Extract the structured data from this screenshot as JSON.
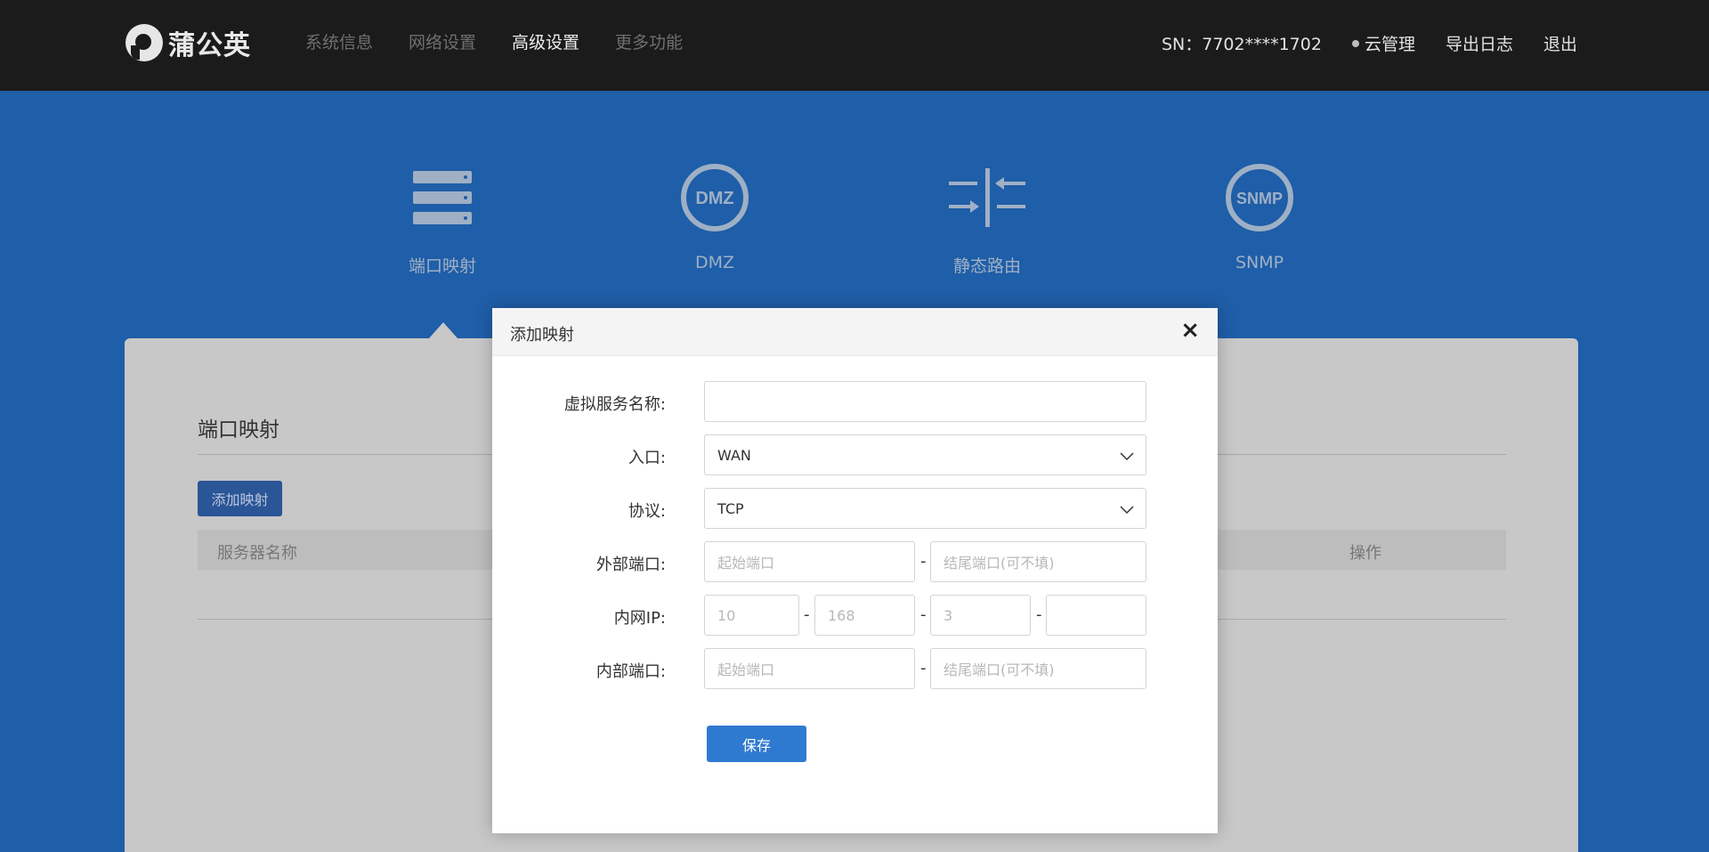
{
  "brand": {
    "name": "蒲公英"
  },
  "nav": {
    "items": [
      {
        "label": "系统信息",
        "active": false
      },
      {
        "label": "网络设置",
        "active": false
      },
      {
        "label": "高级设置",
        "active": true
      },
      {
        "label": "更多功能",
        "active": false
      }
    ]
  },
  "header_right": {
    "sn": "SN：7702****1702",
    "cloud": "云管理",
    "export_log": "导出日志",
    "logout": "退出"
  },
  "features": [
    {
      "label": "端口映射",
      "icon": "server-stack-icon"
    },
    {
      "label": "DMZ",
      "icon": "dmz-circle-icon",
      "icon_text": "DMZ"
    },
    {
      "label": "静态路由",
      "icon": "static-route-icon"
    },
    {
      "label": "SNMP",
      "icon": "snmp-circle-icon",
      "icon_text": "SNMP"
    }
  ],
  "panel": {
    "title": "端口映射",
    "add_button": "添加映射",
    "columns": {
      "name": "服务器名称",
      "ops": "操作"
    }
  },
  "modal": {
    "title": "添加映射",
    "close": "×",
    "fields": {
      "service_name": {
        "label": "虚拟服务名称:",
        "value": ""
      },
      "entry": {
        "label": "入口:",
        "value": "WAN"
      },
      "protocol": {
        "label": "协议:",
        "value": "TCP"
      },
      "external_port": {
        "label": "外部端口:",
        "start_placeholder": "起始端口",
        "end_placeholder": "结尾端口(可不填)"
      },
      "lan_ip": {
        "label": "内网IP:",
        "p1": "10",
        "p2": "168",
        "p3": "3",
        "p4": ""
      },
      "internal_port": {
        "label": "内部端口:",
        "start_placeholder": "起始端口",
        "end_placeholder": "结尾端口(可不填)"
      }
    },
    "dash": "-",
    "save": "保存"
  },
  "colors": {
    "topbar": "#1b1b1b",
    "band": "#1f5ea8",
    "primary": "#2f7ad1"
  }
}
